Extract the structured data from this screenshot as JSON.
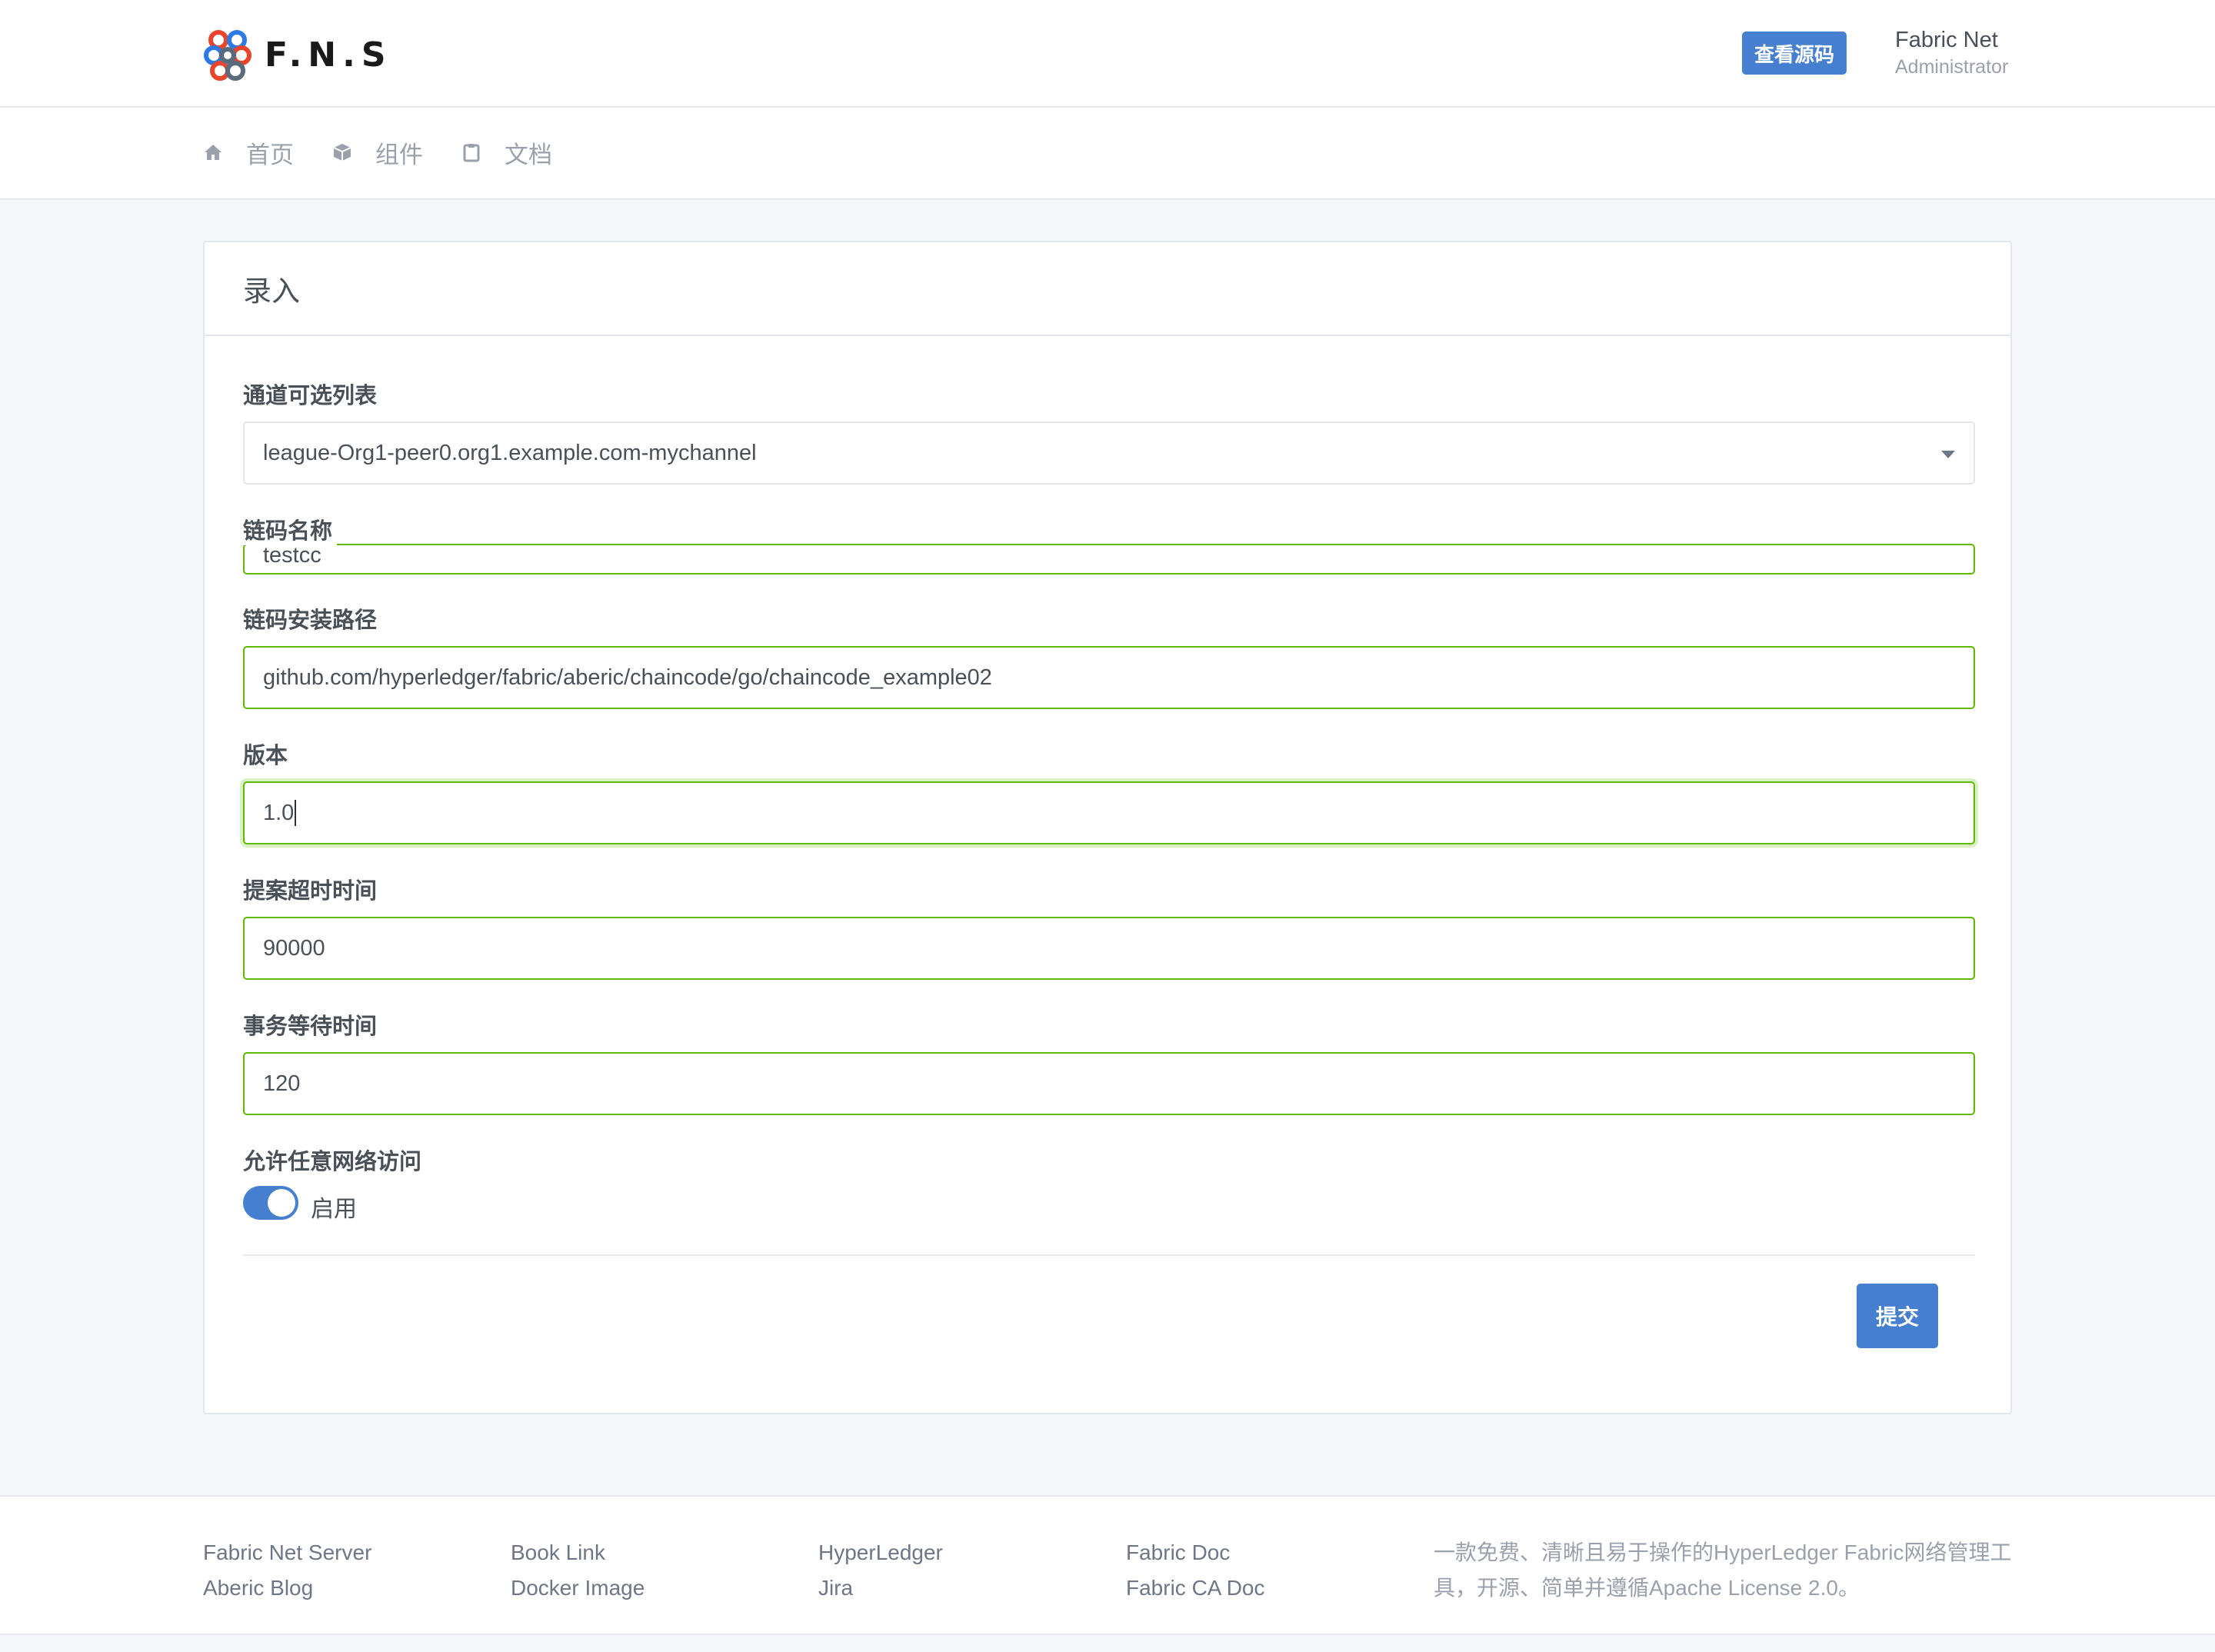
{
  "header": {
    "brand": "F.N.S",
    "source_button": "查看源码",
    "user_name": "Fabric Net",
    "user_role": "Administrator"
  },
  "nav": {
    "items": [
      {
        "label": "首页",
        "icon": "home-icon"
      },
      {
        "label": "组件",
        "icon": "box-icon"
      },
      {
        "label": "文档",
        "icon": "clipboard-icon"
      }
    ]
  },
  "card": {
    "title": "录入",
    "fields": {
      "channel": {
        "label": "通道可选列表",
        "value": "league-Org1-peer0.org1.example.com-mychannel"
      },
      "chaincode_name": {
        "label": "链码名称",
        "value": "testcc"
      },
      "install_path": {
        "label": "链码安装路径",
        "value": "github.com/hyperledger/fabric/aberic/chaincode/go/chaincode_example02"
      },
      "version": {
        "label": "版本",
        "value": "1.0"
      },
      "proposal_timeout": {
        "label": "提案超时时间",
        "value": "90000"
      },
      "tx_wait_time": {
        "label": "事务等待时间",
        "value": "120"
      },
      "allow_any_network": {
        "label": "允许任意网络访问",
        "toggle_label": "启用",
        "enabled": true
      }
    },
    "submit": "提交"
  },
  "footer": {
    "columns": [
      [
        "Fabric Net Server",
        "Aberic Blog"
      ],
      [
        "Book Link",
        "Docker Image"
      ],
      [
        "HyperLedger",
        "Jira"
      ],
      [
        "Fabric Doc",
        "Fabric CA Doc"
      ]
    ],
    "description": "一款免费、清晰且易于操作的HyperLedger Fabric网络管理工具，开源、简单并遵循Apache License 2.0。"
  },
  "colors": {
    "primary": "#467fcf",
    "valid_border": "#5eba00",
    "background": "#f5f7fb"
  }
}
